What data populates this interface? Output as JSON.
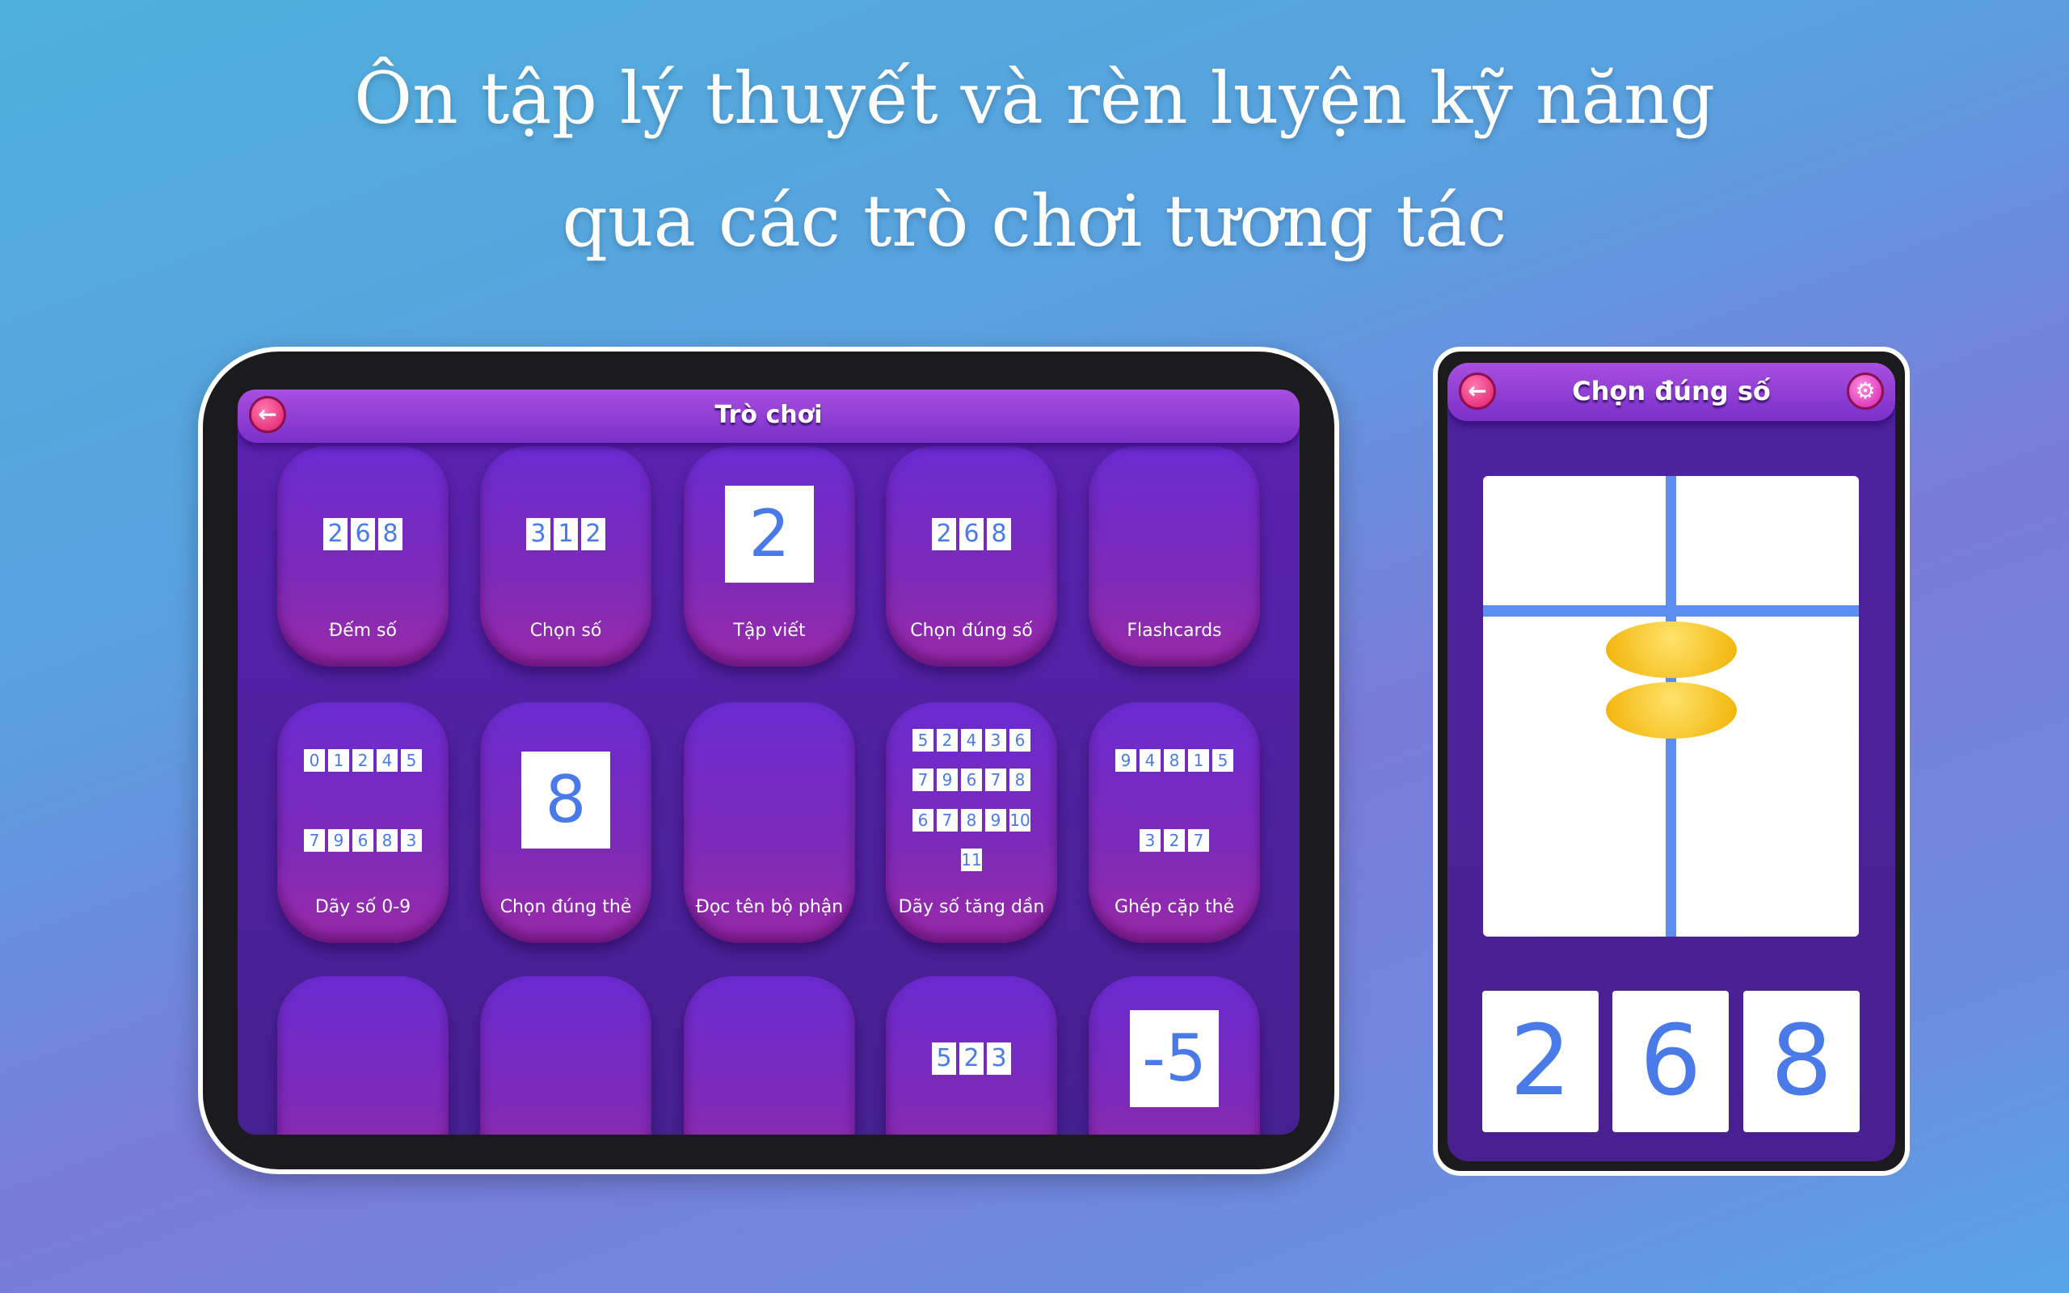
{
  "headline": {
    "line1": "Ôn tập lý thuyết và rèn luyện kỹ năng",
    "line2": "qua các trò chơi tương tác"
  },
  "tablet": {
    "title": "Trò chơi",
    "back_icon": "arrow-left-icon",
    "tiles": [
      {
        "label": "Đếm số",
        "digits": [
          "2",
          "6",
          "8"
        ]
      },
      {
        "label": "Chọn số",
        "digits": [
          "3",
          "1",
          "2"
        ]
      },
      {
        "label": "Tập viết",
        "digits": [
          "2"
        ]
      },
      {
        "label": "Chọn đúng số",
        "digits": [
          "2",
          "6",
          "8"
        ]
      },
      {
        "label": "Flashcards",
        "digits": []
      },
      {
        "label": "Dãy số 0-9",
        "digits": [
          "0",
          "1",
          "2",
          "4",
          "5",
          "7",
          "9",
          "6",
          "8",
          "3"
        ]
      },
      {
        "label": "Chọn đúng thẻ",
        "digits": [
          "8"
        ]
      },
      {
        "label": "Đọc tên bộ phận",
        "digits": []
      },
      {
        "label": "Dãy số tăng dần",
        "digits": [
          "5",
          "2",
          "4",
          "3",
          "6",
          "7",
          "9",
          "6",
          "7",
          "8",
          "6",
          "7",
          "8",
          "9",
          "10",
          "11"
        ]
      },
      {
        "label": "Ghép cặp thẻ",
        "digits": [
          "9",
          "4",
          "8",
          "1",
          "5",
          "3",
          "2",
          "7"
        ]
      },
      {
        "label": "",
        "digits": []
      },
      {
        "label": "",
        "digits": []
      },
      {
        "label": "",
        "digits": []
      },
      {
        "label": "",
        "digits": [
          "5",
          "2",
          "3"
        ]
      },
      {
        "label": "",
        "digits": [
          "-5"
        ]
      }
    ]
  },
  "phone": {
    "title": "Chọn đúng số",
    "back_icon": "arrow-left-icon",
    "settings_icon": "gear-icon",
    "options": [
      "2",
      "6",
      "8"
    ]
  },
  "colors": {
    "accent": "#7a30c8",
    "digit": "#4a7ae8",
    "back": "#e0186a"
  }
}
